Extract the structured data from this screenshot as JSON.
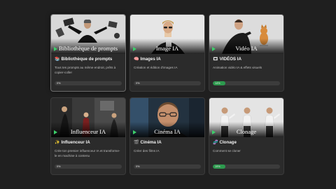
{
  "courses": [
    {
      "overlay": "Bibliothèque de prompts",
      "emoji": "📚",
      "title": "Bibliothèque de prompts",
      "description": "Tous tes prompts au même endroit, prêts à copier-coller",
      "progress_label": "0%",
      "progress": 0
    },
    {
      "overlay": "Image IA",
      "emoji": "🧠",
      "title": "Images IA",
      "description": "Création et édition d'images IA",
      "progress_label": "0%",
      "progress": 0
    },
    {
      "overlay": "Vidéo IA",
      "emoji": "🎞",
      "title": "VIDÉOS IA",
      "description": "Animation vidéo IA & effets visuels",
      "progress_label": "14%",
      "progress": 14
    },
    {
      "overlay": "Influenceur IA",
      "emoji": "✨",
      "title": "Influenceur IA",
      "description": "Crée ton premier influenceur IA et transforme-le en machine à contenu",
      "progress_label": "0%",
      "progress": 0
    },
    {
      "overlay": "Cinéma IA",
      "emoji": "🎬",
      "title": "Cinéma IA",
      "description": "Créer des films IA",
      "progress_label": "0%",
      "progress": 0
    },
    {
      "overlay": "Clonage",
      "emoji": "🧬",
      "title": "Clonage",
      "description": "Comment se cloner",
      "progress_label": "19%",
      "progress": 19
    }
  ],
  "colors": {
    "accent": "#2d9a4e",
    "play": "#3ccf6a",
    "card": "#2b2b2b",
    "background": "#1f1f1f"
  }
}
